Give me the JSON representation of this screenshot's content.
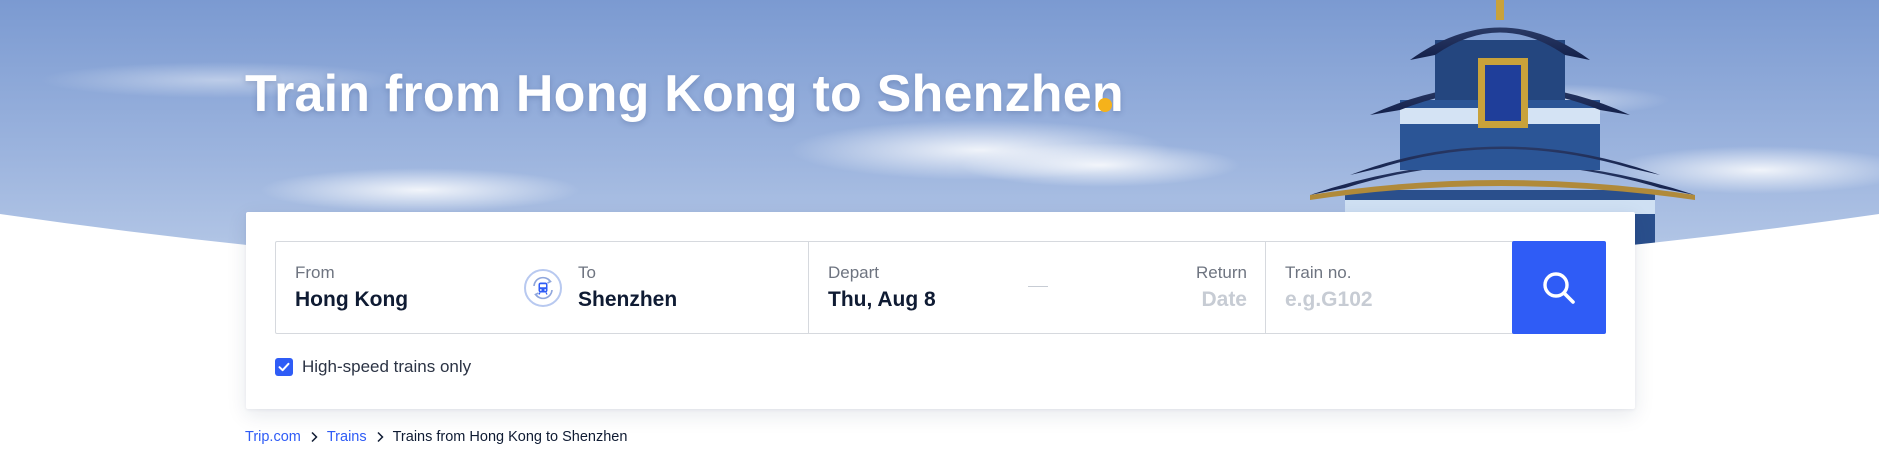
{
  "hero": {
    "title": "Train from Hong Kong to Shenzhen",
    "accent_color": "#f5b21b",
    "sky_color": "#8fa9d6"
  },
  "search": {
    "from": {
      "label": "From",
      "value": "Hong Kong"
    },
    "swap_icon": "train-swap-icon",
    "to": {
      "label": "To",
      "value": "Shenzhen"
    },
    "depart": {
      "label": "Depart",
      "value": "Thu, Aug 8"
    },
    "return": {
      "label": "Return",
      "placeholder": "Date"
    },
    "train_no": {
      "label": "Train no.",
      "placeholder": "e.g.G102"
    },
    "search_icon": "search-icon",
    "button_color": "#2f5cf6"
  },
  "filters": {
    "high_speed_only": {
      "label": "High-speed trains only",
      "checked": true
    }
  },
  "breadcrumb": {
    "items": [
      {
        "label": "Trip.com"
      },
      {
        "label": "Trains"
      }
    ],
    "current": "Trains from Hong Kong to Shenzhen",
    "separator_icon": "chevron-right-icon"
  }
}
